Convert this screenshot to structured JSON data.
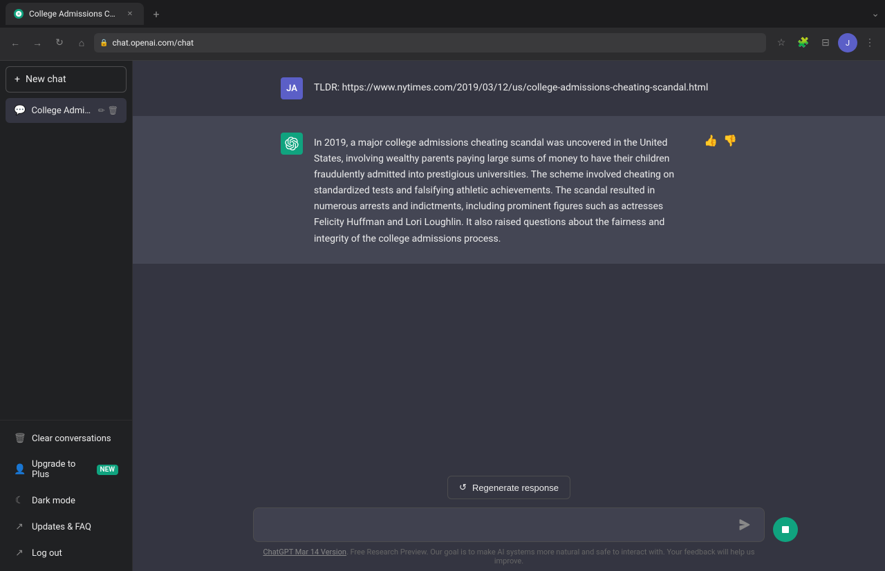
{
  "browser": {
    "tab": {
      "title": "College Admissions Cheating S",
      "url": "chat.openai.com/chat"
    },
    "tab_new_label": "+",
    "nav": {
      "back": "←",
      "forward": "→",
      "reload": "↻",
      "home": "⌂"
    }
  },
  "sidebar": {
    "new_chat_label": "New chat",
    "conversations": [
      {
        "title": "College Admissions Ch",
        "icon": "💬"
      }
    ],
    "bottom_items": [
      {
        "label": "Clear conversations",
        "icon": "🗑"
      },
      {
        "label": "Upgrade to Plus",
        "icon": "👤",
        "badge": "NEW"
      },
      {
        "label": "Dark mode",
        "icon": "☾"
      },
      {
        "label": "Updates & FAQ",
        "icon": "↗"
      },
      {
        "label": "Log out",
        "icon": "↗"
      }
    ]
  },
  "chat": {
    "messages": [
      {
        "role": "user",
        "avatar_initials": "JA",
        "content": "TLDR: https://www.nytimes.com/2019/03/12/us/college-admissions-cheating-scandal.html"
      },
      {
        "role": "assistant",
        "content": "In 2019, a major college admissions cheating scandal was uncovered in the United States, involving wealthy parents paying large sums of money to have their children fraudulently admitted into prestigious universities. The scheme involved cheating on standardized tests and falsifying athletic achievements. The scandal resulted in numerous arrests and indictments, including prominent figures such as actresses Felicity Huffman and Lori Loughlin. It also raised questions about the fairness and integrity of the college admissions process."
      }
    ]
  },
  "input": {
    "placeholder": "",
    "regenerate_label": "Regenerate response",
    "send_icon": "➤"
  },
  "footer": {
    "version_link": "ChatGPT Mar 14 Version",
    "text": ". Free Research Preview. Our goal is to make AI systems more natural and safe to interact with. Your feedback will help us improve."
  }
}
